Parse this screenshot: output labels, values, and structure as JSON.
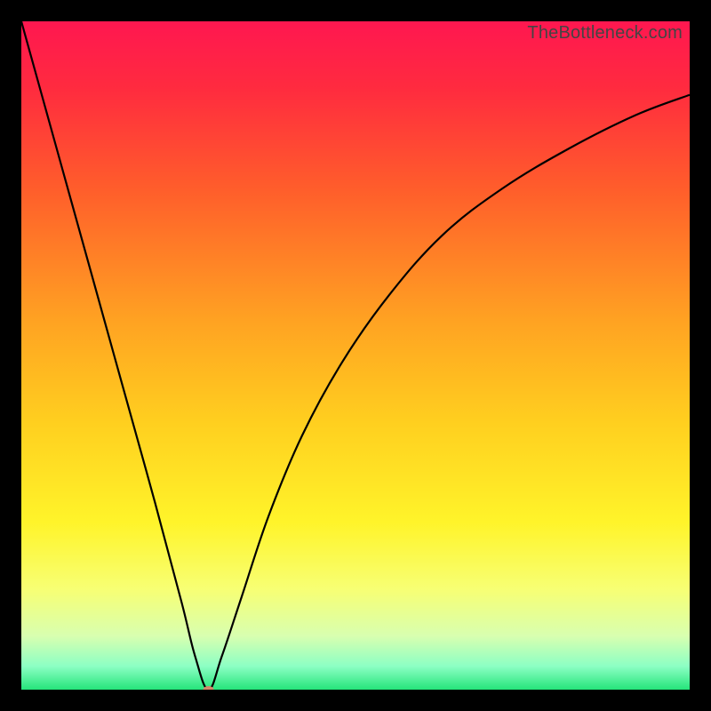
{
  "watermark": "TheBottleneck.com",
  "chart_data": {
    "type": "line",
    "title": "",
    "xlabel": "",
    "ylabel": "",
    "xlim": [
      0,
      100
    ],
    "ylim": [
      0,
      100
    ],
    "grid": false,
    "legend": false,
    "background": {
      "type": "vertical-gradient",
      "stops": [
        {
          "pos": 0.0,
          "color": "#ff1750"
        },
        {
          "pos": 0.1,
          "color": "#ff2b3f"
        },
        {
          "pos": 0.25,
          "color": "#ff5d2b"
        },
        {
          "pos": 0.45,
          "color": "#ffa322"
        },
        {
          "pos": 0.6,
          "color": "#ffcf1f"
        },
        {
          "pos": 0.75,
          "color": "#fff42a"
        },
        {
          "pos": 0.85,
          "color": "#f7ff74"
        },
        {
          "pos": 0.92,
          "color": "#d8ffb0"
        },
        {
          "pos": 0.965,
          "color": "#8cffc4"
        },
        {
          "pos": 1.0,
          "color": "#25e57a"
        }
      ]
    },
    "curve": {
      "description": "Bottleneck curve: steep linear descent from top-left to a minimum near x≈28, then asymptotic rise toward the right.",
      "min_x": 28,
      "min_y": 0,
      "points": [
        {
          "x": 0,
          "y": 100
        },
        {
          "x": 5,
          "y": 82
        },
        {
          "x": 10,
          "y": 64
        },
        {
          "x": 15,
          "y": 46
        },
        {
          "x": 20,
          "y": 28
        },
        {
          "x": 24,
          "y": 13
        },
        {
          "x": 26,
          "y": 5
        },
        {
          "x": 28,
          "y": 0
        },
        {
          "x": 30,
          "y": 5
        },
        {
          "x": 33,
          "y": 14
        },
        {
          "x": 37,
          "y": 26
        },
        {
          "x": 42,
          "y": 38
        },
        {
          "x": 48,
          "y": 49
        },
        {
          "x": 55,
          "y": 59
        },
        {
          "x": 63,
          "y": 68
        },
        {
          "x": 72,
          "y": 75
        },
        {
          "x": 82,
          "y": 81
        },
        {
          "x": 92,
          "y": 86
        },
        {
          "x": 100,
          "y": 89
        }
      ]
    },
    "marker": {
      "x": 28,
      "y": 0,
      "color": "#d4876a",
      "rx": 6,
      "ry": 4
    }
  }
}
